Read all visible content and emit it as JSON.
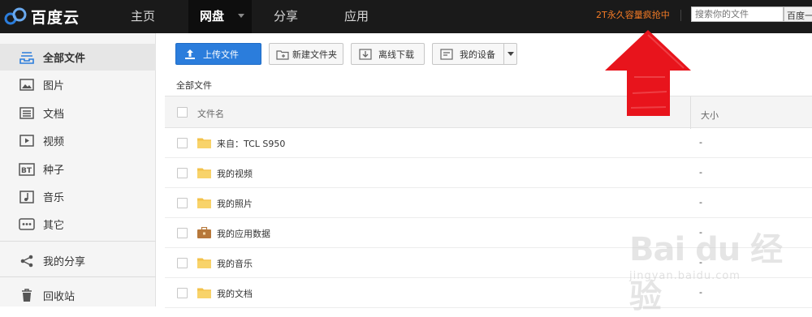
{
  "header": {
    "logo_text": "百度云",
    "nav": [
      {
        "label": "主页",
        "active": false
      },
      {
        "label": "网盘",
        "active": true
      },
      {
        "label": "分享",
        "active": false
      },
      {
        "label": "应用",
        "active": false
      }
    ],
    "promo": "2T永久容量疯抢中",
    "search_placeholder": "搜索你的文件",
    "search_scope": "百度一下"
  },
  "sidebar": {
    "items": [
      {
        "label": "全部文件",
        "icon": "all-files-icon",
        "active": true
      },
      {
        "label": "图片",
        "icon": "image-icon"
      },
      {
        "label": "文档",
        "icon": "document-icon"
      },
      {
        "label": "视频",
        "icon": "video-icon"
      },
      {
        "label": "种子",
        "icon": "bt-icon"
      },
      {
        "label": "音乐",
        "icon": "music-icon"
      },
      {
        "label": "其它",
        "icon": "more-icon"
      },
      {
        "label": "我的分享",
        "icon": "share-icon"
      },
      {
        "label": "回收站",
        "icon": "trash-icon"
      }
    ]
  },
  "toolbar": {
    "upload": "上传文件",
    "new_folder": "新建文件夹",
    "offline_download": "离线下载",
    "my_devices": "我的设备"
  },
  "breadcrumb": "全部文件",
  "table": {
    "columns": [
      "文件名",
      "大小"
    ],
    "rows": [
      {
        "name": "来自：TCL S950",
        "size": "-",
        "type": "folder"
      },
      {
        "name": "我的视频",
        "size": "-",
        "type": "folder"
      },
      {
        "name": "我的照片",
        "size": "-",
        "type": "folder"
      },
      {
        "name": "我的应用数据",
        "size": "-",
        "type": "app-folder"
      },
      {
        "name": "我的音乐",
        "size": "-",
        "type": "folder"
      },
      {
        "name": "我的文档",
        "size": "-",
        "type": "folder"
      }
    ]
  },
  "watermark": {
    "main": "Bai du 经验",
    "sub": "jingyan.baidu.com"
  },
  "colors": {
    "topbar": "#1a1a1a",
    "accent": "#2b7ddc",
    "promo": "#f47b25",
    "arrow": "#e8141c"
  }
}
